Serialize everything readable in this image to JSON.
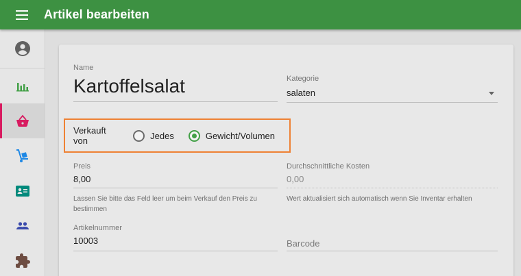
{
  "appbar": {
    "title": "Artikel bearbeiten"
  },
  "sidebar": {
    "items": [
      {
        "name": "account",
        "icon": "account-circle-icon"
      },
      {
        "name": "reports",
        "icon": "bar-chart-icon"
      },
      {
        "name": "sales",
        "icon": "basket-icon",
        "active": true
      },
      {
        "name": "inventory",
        "icon": "hand-truck-icon"
      },
      {
        "name": "contacts",
        "icon": "contact-card-icon"
      },
      {
        "name": "users",
        "icon": "people-icon"
      },
      {
        "name": "extensions",
        "icon": "puzzle-icon"
      }
    ]
  },
  "form": {
    "name": {
      "label": "Name",
      "value": "Kartoffelsalat"
    },
    "category": {
      "label": "Kategorie",
      "value": "salaten"
    },
    "sold_by": {
      "label": "Verkauft von",
      "options": [
        {
          "label": "Jedes",
          "checked": false
        },
        {
          "label": "Gewicht/Volumen",
          "checked": true
        }
      ]
    },
    "price": {
      "label": "Preis",
      "value": "8,00",
      "hint": "Lassen Sie bitte das Feld leer um beim Verkauf den Preis zu bestimmen"
    },
    "avg_cost": {
      "label": "Durchschnittliche Kosten",
      "value": "0,00",
      "hint": "Wert aktualisiert sich automatisch wenn Sie Inventar erhalten"
    },
    "article_number": {
      "label": "Artikelnummer",
      "value": "10003"
    },
    "barcode": {
      "placeholder": "Barcode"
    }
  },
  "colors": {
    "appbar": "#3d9142",
    "accent_pink": "#d81b60",
    "radio_green": "#43a047",
    "highlight_orange": "#ee8133"
  }
}
